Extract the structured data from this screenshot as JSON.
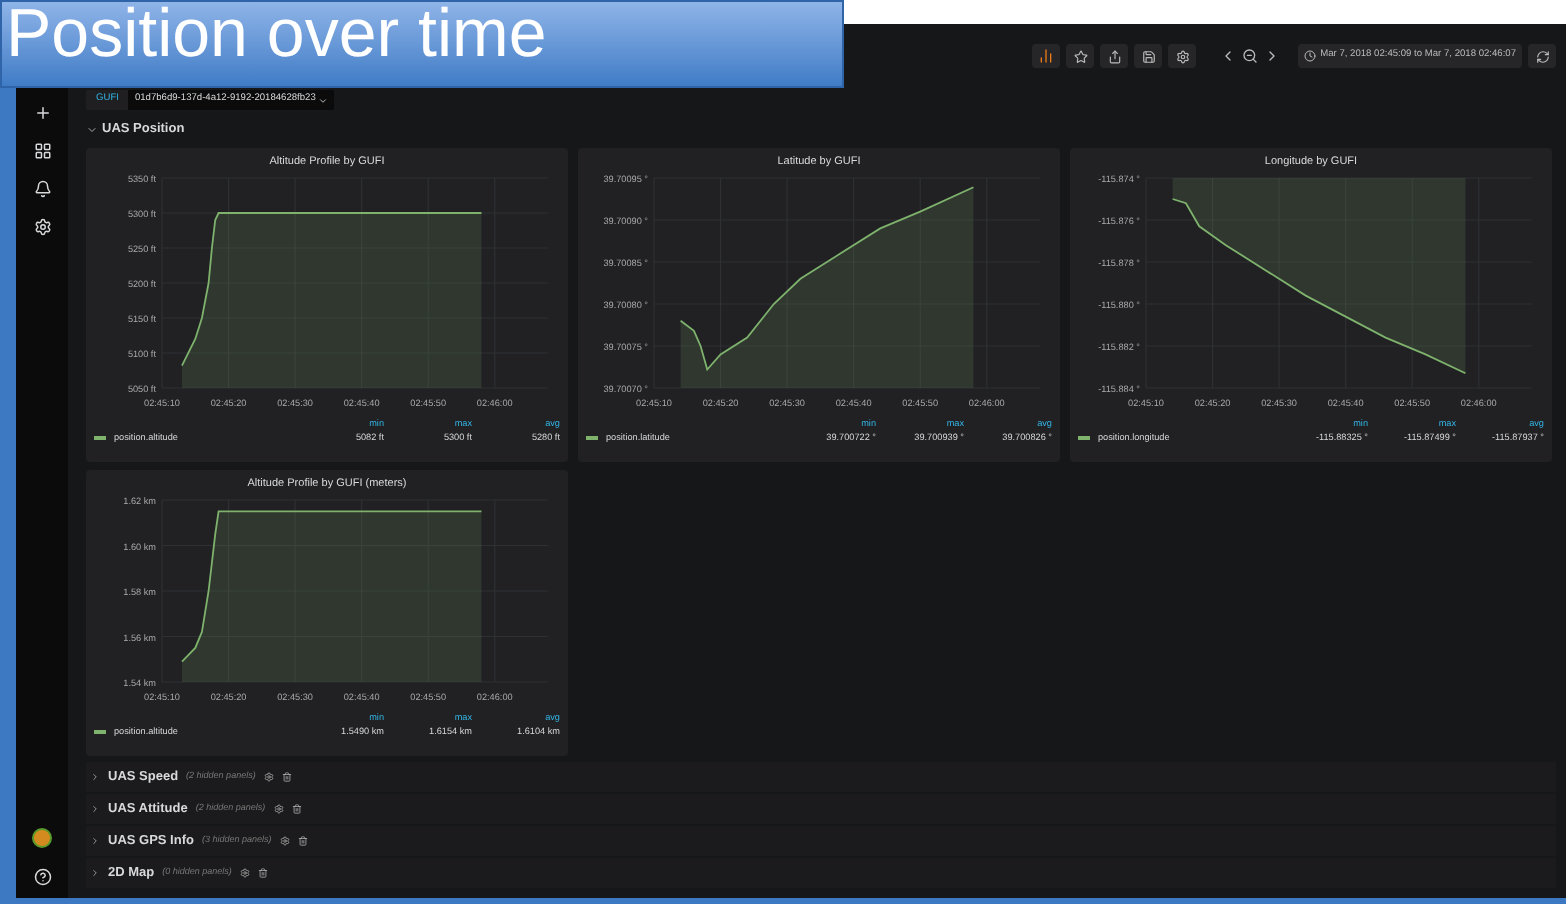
{
  "overlay_title": "Position over time",
  "toolbar": {
    "time_range": "Mar 7, 2018 02:45:09 to Mar 7, 2018 02:46:07"
  },
  "variable": {
    "label": "GUFI",
    "value": "01d7b6d9-137d-4a12-9192-20184628fb23"
  },
  "section": {
    "title": "UAS Position",
    "expanded": true
  },
  "panels": [
    {
      "title": "Altitude Profile by GUFI",
      "legend": {
        "columns": [
          "min",
          "max",
          "avg"
        ],
        "values": [
          "5082 ft",
          "5300 ft",
          "5280 ft"
        ]
      },
      "chart_data": {
        "type": "area",
        "grid": true,
        "x": [
          9913,
          9915,
          9916,
          9917,
          9917.5,
          9918,
          9918.5,
          9958
        ],
        "series": [
          {
            "name": "position.altitude",
            "color": "#7eb26d",
            "values": [
              5082,
              5120,
              5150,
              5200,
              5250,
              5290,
              5300,
              5300
            ]
          }
        ],
        "xlim": [
          9910,
          9968
        ],
        "ylim": [
          5050,
          5350
        ],
        "xticks": [
          {
            "value": 9910,
            "label": "02:45:10"
          },
          {
            "value": 9920,
            "label": "02:45:20"
          },
          {
            "value": 9930,
            "label": "02:45:30"
          },
          {
            "value": 9940,
            "label": "02:45:40"
          },
          {
            "value": 9950,
            "label": "02:45:50"
          },
          {
            "value": 9960,
            "label": "02:46:00"
          }
        ],
        "yticks": [
          {
            "value": 5050,
            "label": "5050 ft"
          },
          {
            "value": 5100,
            "label": "5100 ft"
          },
          {
            "value": 5150,
            "label": "5150 ft"
          },
          {
            "value": 5200,
            "label": "5200 ft"
          },
          {
            "value": 5250,
            "label": "5250 ft"
          },
          {
            "value": 5300,
            "label": "5300 ft"
          },
          {
            "value": 5350,
            "label": "5350 ft"
          }
        ]
      }
    },
    {
      "title": "Latitude by GUFI",
      "legend": {
        "columns": [
          "min",
          "max",
          "avg"
        ],
        "values": [
          "39.700722 °",
          "39.700939 °",
          "39.700826 °"
        ]
      },
      "chart_data": {
        "type": "area",
        "grid": true,
        "x": [
          9914,
          9916,
          9917,
          9918,
          9920,
          9924,
          9928,
          9932,
          9938,
          9944,
          9950,
          9958
        ],
        "series": [
          {
            "name": "position.latitude",
            "color": "#7eb26d",
            "values": [
              39.70078,
              39.700768,
              39.70075,
              39.700722,
              39.70074,
              39.70076,
              39.7008,
              39.70083,
              39.70086,
              39.70089,
              39.70091,
              39.700939
            ]
          }
        ],
        "xlim": [
          9910,
          9968
        ],
        "ylim": [
          39.7007,
          39.70095
        ],
        "xticks": [
          {
            "value": 9910,
            "label": "02:45:10"
          },
          {
            "value": 9920,
            "label": "02:45:20"
          },
          {
            "value": 9930,
            "label": "02:45:30"
          },
          {
            "value": 9940,
            "label": "02:45:40"
          },
          {
            "value": 9950,
            "label": "02:45:50"
          },
          {
            "value": 9960,
            "label": "02:46:00"
          }
        ],
        "yticks": [
          {
            "value": 39.7007,
            "label": "39.70070 °"
          },
          {
            "value": 39.70075,
            "label": "39.70075 °"
          },
          {
            "value": 39.7008,
            "label": "39.70080 °"
          },
          {
            "value": 39.70085,
            "label": "39.70085 °"
          },
          {
            "value": 39.7009,
            "label": "39.70090 °"
          },
          {
            "value": 39.70095,
            "label": "39.70095 °"
          }
        ]
      }
    },
    {
      "title": "Longitude by GUFI",
      "legend": {
        "columns": [
          "min",
          "max",
          "avg"
        ],
        "values": [
          "-115.88325 °",
          "-115.87499 °",
          "-115.87937 °"
        ]
      },
      "chart_data": {
        "type": "area",
        "grid": true,
        "x": [
          9914,
          9916,
          9918,
          9922,
          9928,
          9934,
          9940,
          9946,
          9952,
          9958
        ],
        "series": [
          {
            "name": "position.longitude",
            "color": "#7eb26d",
            "values": [
              -115.875,
              -115.8752,
              -115.8763,
              -115.8772,
              -115.8784,
              -115.8796,
              -115.8806,
              -115.8816,
              -115.8824,
              -115.8833
            ]
          }
        ],
        "xlim": [
          9910,
          9968
        ],
        "ylim": [
          -115.884,
          -115.874
        ],
        "xticks": [
          {
            "value": 9910,
            "label": "02:45:10"
          },
          {
            "value": 9920,
            "label": "02:45:20"
          },
          {
            "value": 9930,
            "label": "02:45:30"
          },
          {
            "value": 9940,
            "label": "02:45:40"
          },
          {
            "value": 9950,
            "label": "02:45:50"
          },
          {
            "value": 9960,
            "label": "02:46:00"
          }
        ],
        "yticks": [
          {
            "value": -115.884,
            "label": "-115.884 °"
          },
          {
            "value": -115.882,
            "label": "-115.882 °"
          },
          {
            "value": -115.88,
            "label": "-115.880 °"
          },
          {
            "value": -115.878,
            "label": "-115.878 °"
          },
          {
            "value": -115.876,
            "label": "-115.876 °"
          },
          {
            "value": -115.874,
            "label": "-115.874 °"
          }
        ]
      }
    },
    {
      "title": "Altitude Profile by GUFI (meters)",
      "legend": {
        "columns": [
          "min",
          "max",
          "avg"
        ],
        "values": [
          "1.5490 km",
          "1.6154 km",
          "1.6104 km"
        ]
      },
      "chart_data": {
        "type": "area",
        "grid": true,
        "x": [
          9913,
          9915,
          9916,
          9917,
          9918,
          9918.5,
          9958
        ],
        "series": [
          {
            "name": "position.altitude",
            "color": "#7eb26d",
            "values": [
              1.549,
              1.555,
              1.562,
              1.58,
              1.605,
              1.615,
              1.615
            ]
          }
        ],
        "xlim": [
          9910,
          9968
        ],
        "ylim": [
          1.54,
          1.62
        ],
        "xticks": [
          {
            "value": 9910,
            "label": "02:45:10"
          },
          {
            "value": 9920,
            "label": "02:45:20"
          },
          {
            "value": 9930,
            "label": "02:45:30"
          },
          {
            "value": 9940,
            "label": "02:45:40"
          },
          {
            "value": 9950,
            "label": "02:45:50"
          },
          {
            "value": 9960,
            "label": "02:46:00"
          }
        ],
        "yticks": [
          {
            "value": 1.54,
            "label": "1.54 km"
          },
          {
            "value": 1.56,
            "label": "1.56 km"
          },
          {
            "value": 1.58,
            "label": "1.58 km"
          },
          {
            "value": 1.6,
            "label": "1.60 km"
          },
          {
            "value": 1.62,
            "label": "1.62 km"
          }
        ]
      }
    }
  ],
  "rows": [
    {
      "title": "UAS Speed",
      "note": "(2 hidden panels)",
      "expanded": false
    },
    {
      "title": "UAS Attitude",
      "note": "(2 hidden panels)",
      "expanded": false
    },
    {
      "title": "UAS GPS Info",
      "note": "(3 hidden panels)",
      "expanded": false
    },
    {
      "title": "2D Map",
      "note": "(0 hidden panels)",
      "expanded": false
    }
  ]
}
